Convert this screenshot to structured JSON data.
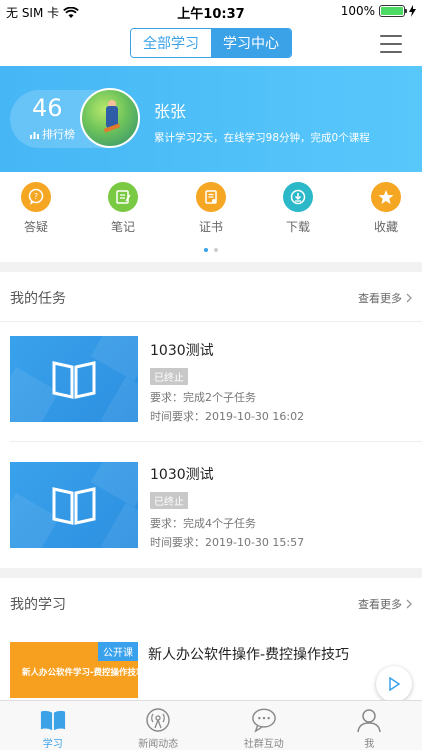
{
  "status_bar": {
    "carrier": "无 SIM 卡",
    "time": "上午10:37",
    "battery_percent": "100%",
    "battery_level": 1.0
  },
  "nav": {
    "segments": [
      {
        "label": "全部学习",
        "active": false
      },
      {
        "label": "学习中心",
        "active": true
      }
    ],
    "menu_icon": "hamburger-icon"
  },
  "profile": {
    "rank_value": "46",
    "rank_label": "排行榜",
    "name": "张张",
    "stats": "累计学习2天，在线学习98分钟，完成0个课程"
  },
  "quick_actions": [
    {
      "label": "答疑",
      "icon": "question-chat-icon",
      "color": "#f5a623"
    },
    {
      "label": "笔记",
      "icon": "note-icon",
      "color": "#7ac943"
    },
    {
      "label": "证书",
      "icon": "certificate-icon",
      "color": "#f5a623"
    },
    {
      "label": "下载",
      "icon": "download-icon",
      "color": "#2bb8c8"
    },
    {
      "label": "收藏",
      "icon": "star-icon",
      "color": "#f5a623"
    }
  ],
  "pager": {
    "pages": 2,
    "current": 1
  },
  "tasks_section": {
    "title": "我的任务",
    "more": "查看更多",
    "items": [
      {
        "title": "1030测试",
        "badge": "已终止",
        "requirement": "要求：完成2个子任务",
        "time": "时间要求：2019-10-30 16:02"
      },
      {
        "title": "1030测试",
        "badge": "已终止",
        "requirement": "要求：完成4个子任务",
        "time": "时间要求：2019-10-30 15:57"
      }
    ]
  },
  "study_section": {
    "title": "我的学习",
    "more": "查看更多",
    "items": [
      {
        "tag": "公开课",
        "thumb_text": "新人办公软件学习-费控操作技巧",
        "title": "新人办公软件操作-费控操作技巧"
      }
    ]
  },
  "tab_bar": [
    {
      "label": "学习",
      "icon": "book-icon",
      "active": true
    },
    {
      "label": "新闻动态",
      "icon": "broadcast-icon",
      "active": false
    },
    {
      "label": "社群互动",
      "icon": "chat-bubble-icon",
      "active": false
    },
    {
      "label": "我",
      "icon": "person-icon",
      "active": false
    }
  ]
}
